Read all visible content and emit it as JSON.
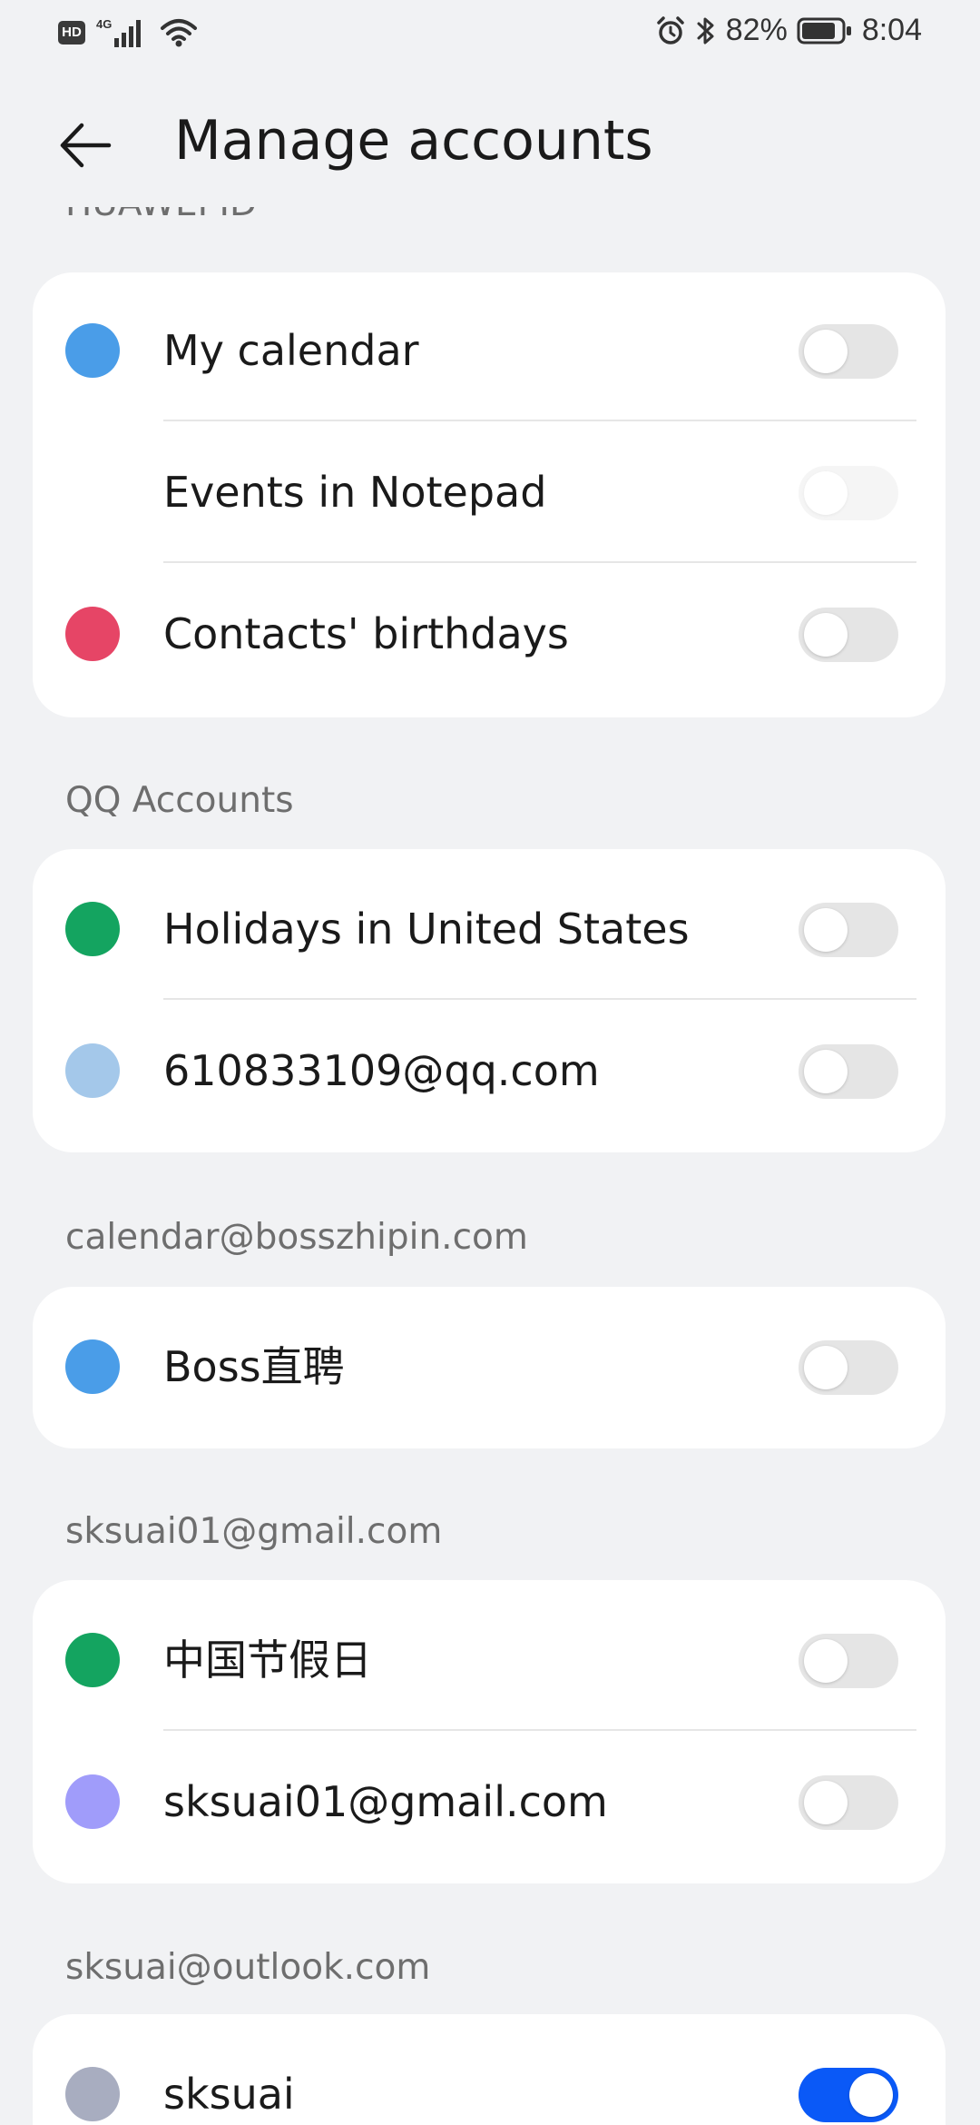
{
  "status_bar": {
    "network": "4G",
    "hd_badge": "HD",
    "battery_percent": "82%",
    "time": "8:04",
    "icons": [
      "hd-icon",
      "signal-icon",
      "wifi-icon",
      "alarm-icon",
      "bluetooth-icon",
      "battery-icon"
    ]
  },
  "header": {
    "title": "Manage accounts",
    "back_icon": "back-arrow-icon"
  },
  "sections": [
    {
      "title": "HUAWEI ID",
      "items": [
        {
          "label": "My calendar",
          "color": "#4a9de8",
          "enabled": false
        },
        {
          "label": "Events in Notepad",
          "color": null,
          "enabled": false
        },
        {
          "label": "Contacts' birthdays",
          "color": "#e64566",
          "enabled": false
        }
      ]
    },
    {
      "title": "QQ Accounts",
      "items": [
        {
          "label": "Holidays in United States",
          "color": "#14a460",
          "enabled": false
        },
        {
          "label": "610833109@qq.com",
          "color": "#a4c8ea",
          "enabled": false
        }
      ]
    },
    {
      "title": "calendar@bosszhipin.com",
      "items": [
        {
          "label": "Boss直聘",
          "color": "#4a9de8",
          "enabled": false
        }
      ]
    },
    {
      "title": "sksuai01@gmail.com",
      "items": [
        {
          "label": "中国节假日",
          "color": "#14a460",
          "enabled": false
        },
        {
          "label": "sksuai01@gmail.com",
          "color": "#a09cfa",
          "enabled": false
        }
      ]
    },
    {
      "title": "sksuai@outlook.com",
      "items": [
        {
          "label": "sksuai",
          "color": "#a8adc0",
          "enabled": true
        }
      ]
    }
  ]
}
